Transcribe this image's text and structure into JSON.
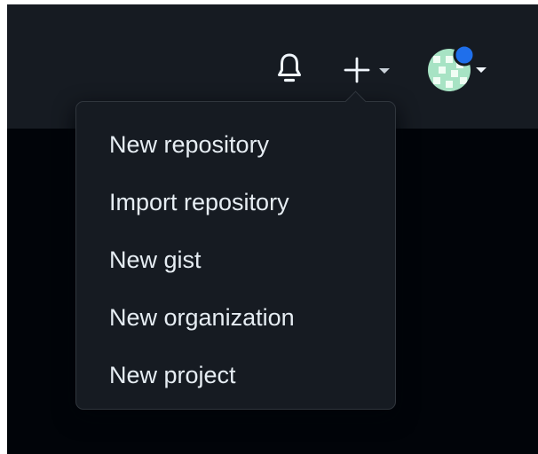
{
  "header": {
    "icons": {
      "bell": "bell-icon",
      "plus": "plus-icon",
      "caret": "caret-down-icon",
      "avatar": "avatar-identicon"
    }
  },
  "menu": {
    "items": [
      {
        "label": "New repository"
      },
      {
        "label": "Import repository"
      },
      {
        "label": "New gist"
      },
      {
        "label": "New organization"
      },
      {
        "label": "New project"
      }
    ]
  },
  "colors": {
    "header_bg": "#161b22",
    "page_bg": "#010409",
    "menu_bg": "#161b22",
    "menu_border": "#30363d",
    "menu_text": "#e6edf3",
    "notification_dot": "#1f6feb"
  }
}
